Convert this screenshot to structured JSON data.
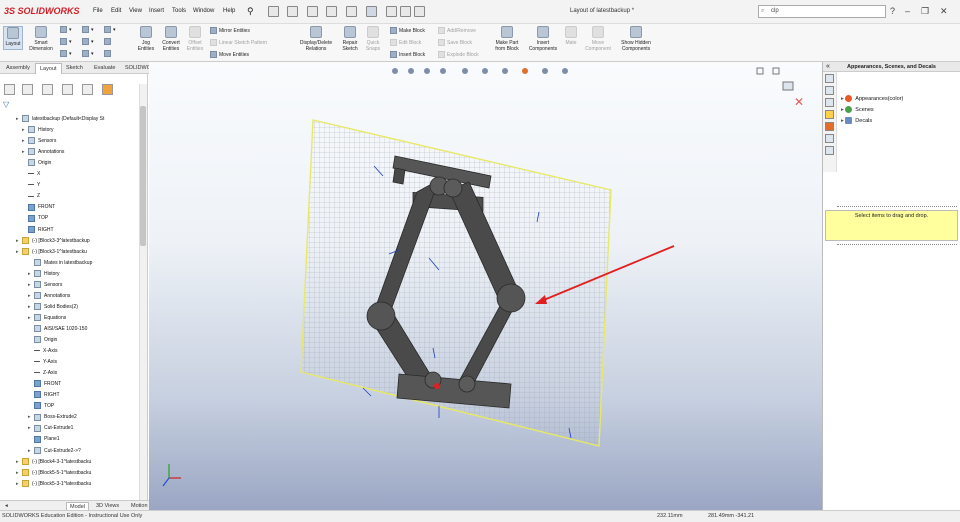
{
  "app": {
    "brand": "SOLIDWORKS",
    "window_title": "Layout of latestbackup *"
  },
  "menu": [
    "File",
    "Edit",
    "View",
    "Insert",
    "Tools",
    "Window",
    "Help"
  ],
  "search": {
    "value": "clp"
  },
  "ribbon": {
    "layout": "Layout",
    "smart_dimension": "Smart Dimension",
    "sketch_tools": {
      "jog": "Jog Entities",
      "convert": "Convert Entities",
      "offset": "Offset Entities"
    },
    "mirror": "Mirror Entities",
    "linear_pattern": "Linear Sketch Pattern",
    "move": "Move Entities",
    "display_delete": "Display/Delete Relations",
    "repair": "Repair Sketch",
    "quick_snaps": "Quick Snaps",
    "make_block": "Make Block",
    "edit_block": "Edit Block",
    "insert_block": "Insert Block",
    "add_remove": "Add/Remove",
    "save_block": "Save Block",
    "explode_block": "Explode Block",
    "make_part": "Make Part from Block",
    "insert_components": "Insert Components",
    "mate": "Mate",
    "move_component": "Move Component",
    "show_hidden": "Show Hidden Components"
  },
  "cm_tabs": [
    "Assembly",
    "Layout",
    "Sketch",
    "Evaluate",
    "SOLIDWORKS Add-Ins"
  ],
  "tree": [
    {
      "label": "latestbackup  (Default<Display St",
      "indent": 0,
      "icon": "assembly-icon"
    },
    {
      "label": "History",
      "indent": 1,
      "icon": "history-icon"
    },
    {
      "label": "Sensors",
      "indent": 1,
      "icon": "sensor-icon"
    },
    {
      "label": "Annotations",
      "indent": 1,
      "icon": "annotation-icon"
    },
    {
      "label": "Origin",
      "indent": 1,
      "icon": "origin-icon"
    },
    {
      "label": "X",
      "indent": 1,
      "icon": "axis-icon"
    },
    {
      "label": "Y",
      "indent": 1,
      "icon": "axis-icon"
    },
    {
      "label": "Z",
      "indent": 1,
      "icon": "axis-icon"
    },
    {
      "label": "FRONT",
      "indent": 1,
      "icon": "plane-icon"
    },
    {
      "label": "TOP",
      "indent": 1,
      "icon": "plane-icon"
    },
    {
      "label": "RIGHT",
      "indent": 1,
      "icon": "plane-icon"
    },
    {
      "label": "(-) [Block3-3^latestbackup",
      "indent": 0,
      "icon": "block-icon"
    },
    {
      "label": "(-) [Block3-1^latestbacku",
      "indent": 0,
      "icon": "block-icon"
    },
    {
      "label": "Mates in latestbackup",
      "indent": 2,
      "icon": "mates-icon"
    },
    {
      "label": "History",
      "indent": 2,
      "icon": "history-icon"
    },
    {
      "label": "Sensors",
      "indent": 2,
      "icon": "sensor-icon"
    },
    {
      "label": "Annotations",
      "indent": 2,
      "icon": "annotation-icon"
    },
    {
      "label": "Solid Bodies(2)",
      "indent": 2,
      "icon": "bodies-icon"
    },
    {
      "label": "Equations",
      "indent": 2,
      "icon": "equation-icon"
    },
    {
      "label": "AISI/SAE 1020-150",
      "indent": 2,
      "icon": "material-icon"
    },
    {
      "label": "Origin",
      "indent": 2,
      "icon": "origin-icon"
    },
    {
      "label": "X-Axis",
      "indent": 2,
      "icon": "axis-icon"
    },
    {
      "label": "Y-Axis",
      "indent": 2,
      "icon": "axis-icon"
    },
    {
      "label": "Z-Axis",
      "indent": 2,
      "icon": "axis-icon"
    },
    {
      "label": "FRONT",
      "indent": 2,
      "icon": "plane-icon"
    },
    {
      "label": "RIGHT",
      "indent": 2,
      "icon": "plane-icon"
    },
    {
      "label": "TOP",
      "indent": 2,
      "icon": "plane-icon"
    },
    {
      "label": "Boss-Extrude2",
      "indent": 2,
      "icon": "feature-icon"
    },
    {
      "label": "Cut-Extrude1",
      "indent": 2,
      "icon": "feature-icon"
    },
    {
      "label": "Plane1",
      "indent": 2,
      "icon": "plane-icon"
    },
    {
      "label": "Cut-Extrude2->?",
      "indent": 2,
      "icon": "feature-icon"
    },
    {
      "label": "(-) [Block4-3-1^latestbacku",
      "indent": 0,
      "icon": "block-icon"
    },
    {
      "label": "(-) [Block5-5-1^latestbacku",
      "indent": 0,
      "icon": "block-icon"
    },
    {
      "label": "(-) [Block5-3-1^latestbacku",
      "indent": 0,
      "icon": "block-icon"
    }
  ],
  "bottom_tabs": [
    "Model",
    "3D Views",
    "Motion Study 1"
  ],
  "status": {
    "left": "SOLIDWORKS Education Edition - Instructional Use Only",
    "coord1": "232.11mm",
    "coord2": "281.49mm  -341.21"
  },
  "taskpane": {
    "title": "Appearances, Scenes, and Decals",
    "items": [
      "Appearances(color)",
      "Scenes",
      "Decals"
    ],
    "hint": "Select items to drag and drop."
  },
  "colors": {
    "brand": "#d21f26",
    "annotation_arrow": "#e02020",
    "plane_edge": "#e8e866"
  }
}
